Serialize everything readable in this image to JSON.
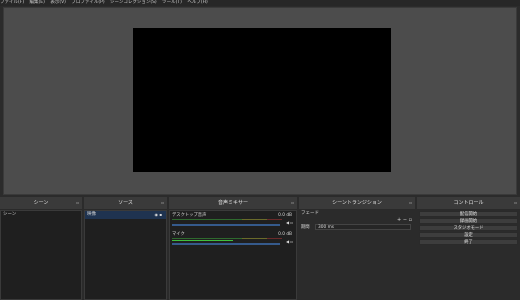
{
  "menubar": {
    "items": [
      "ファイル(F)",
      "編集(E)",
      "表示(V)",
      "プロファイル(P)",
      "シーンコレクション(S)",
      "ツール(T)",
      "ヘルプ(H)"
    ]
  },
  "docks": {
    "scenes": {
      "title": "シーン",
      "items": [
        "シーン"
      ]
    },
    "sources": {
      "title": "ソース",
      "items": [
        {
          "label": "映像",
          "selected": true
        }
      ]
    },
    "mixer": {
      "title": "音声ミキサー",
      "channels": [
        {
          "name": "デスクトップ音声",
          "db": "0.0 dB",
          "level": 0.0
        },
        {
          "name": "マイク",
          "db": "0.0 dB",
          "level": 0.55
        }
      ]
    },
    "transitions": {
      "title": "シーントランジション",
      "current": "フェード",
      "duration_label": "期間",
      "duration_value": "300 ms",
      "add": "+",
      "remove": "−"
    },
    "controls": {
      "title": "コントロール",
      "buttons": [
        "配信開始",
        "録画開始",
        "スタジオモード",
        "設定",
        "終了"
      ]
    }
  },
  "colors": {
    "accent": "#1f3350",
    "meter_green": "#3fbf3f",
    "meter_yellow": "#c8c83a",
    "meter_red": "#c83a3a"
  }
}
